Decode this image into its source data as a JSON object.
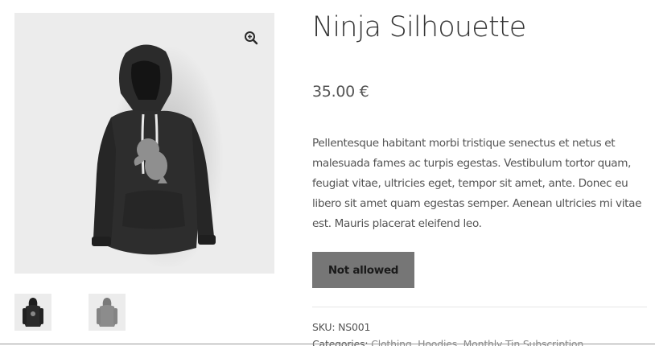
{
  "product": {
    "title": "Ninja Silhouette",
    "price": "35.00 €",
    "description": "Pellentesque habitant morbi tristique senectus et netus et malesuada fames ac turpis egestas. Vestibulum tortor quam, feugiat vitae, ultricies eget, tempor sit amet, ante. Donec eu libero sit amet quam egestas semper. Aenean ultricies mi vitae est. Mauris placerat eleifend leo.",
    "button_label": "Not allowed",
    "sku_label": "SKU:",
    "sku_value": "NS001",
    "categories_label": "Categories:",
    "categories_links": "Clothing, Hoodies, Monthly Tin Subscription"
  },
  "gallery": {
    "zoom_icon": "zoom-in-icon",
    "thumbnails": [
      {
        "name": "black hoodie thumbnail",
        "color": "#2b2b2b"
      },
      {
        "name": "gray hoodie thumbnail",
        "color": "#8c8c8c"
      }
    ]
  },
  "colors": {
    "hoodie_black": "#2b2b2b",
    "hoodie_gray": "#8c8c8c",
    "gallery_bg": "#ececec",
    "button_bg": "#767676"
  }
}
